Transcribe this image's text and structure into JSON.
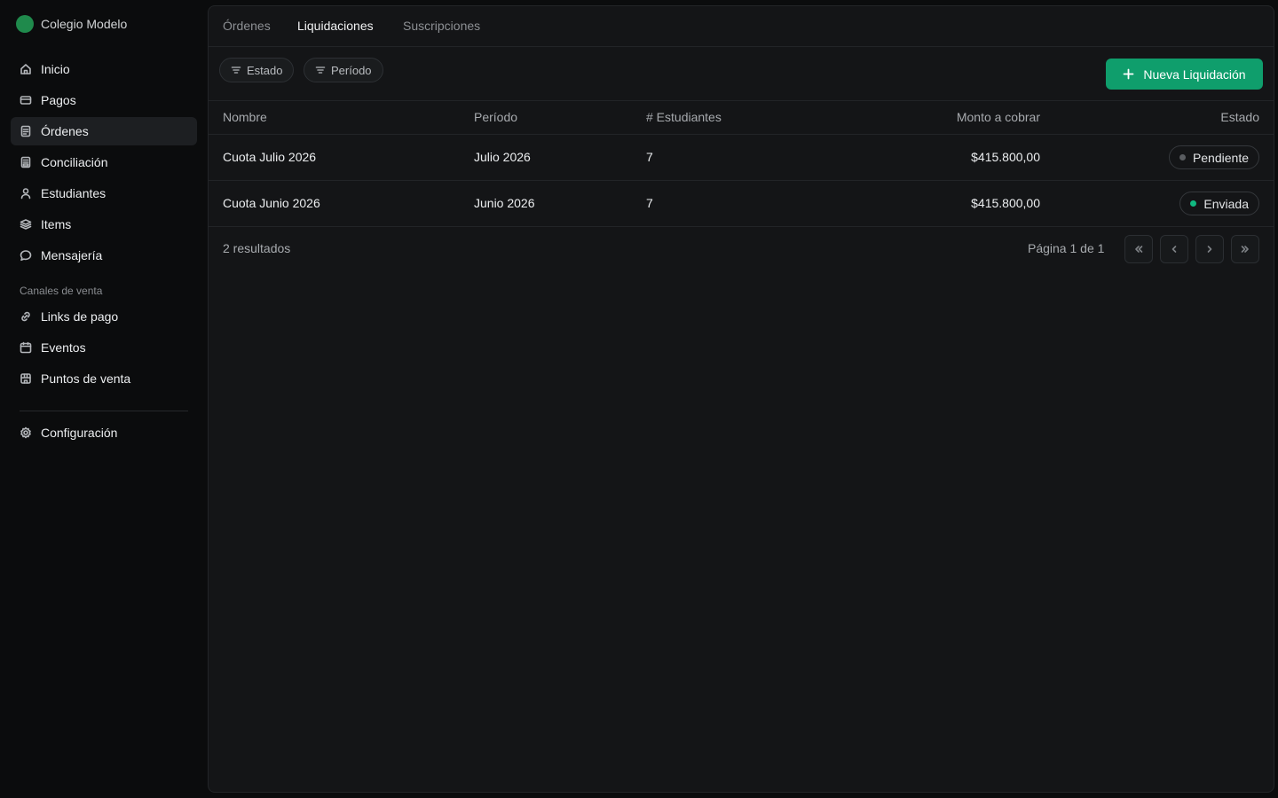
{
  "brand": {
    "name": "Colegio Modelo"
  },
  "sidebar": {
    "items": [
      {
        "label": "Inicio",
        "icon": "home-icon"
      },
      {
        "label": "Pagos",
        "icon": "credit-card-icon"
      },
      {
        "label": "Órdenes",
        "icon": "document-icon",
        "active": true
      },
      {
        "label": "Conciliación",
        "icon": "ledger-icon"
      },
      {
        "label": "Estudiantes",
        "icon": "user-icon"
      },
      {
        "label": "Items",
        "icon": "layers-icon"
      },
      {
        "label": "Mensajería",
        "icon": "message-icon"
      }
    ],
    "section_label": "Canales de venta",
    "channel_items": [
      {
        "label": "Links de pago",
        "icon": "link-icon"
      },
      {
        "label": "Eventos",
        "icon": "calendar-icon"
      },
      {
        "label": "Puntos de venta",
        "icon": "store-icon"
      }
    ],
    "settings": {
      "label": "Configuración",
      "icon": "gear-icon"
    }
  },
  "tabs": [
    {
      "label": "Órdenes"
    },
    {
      "label": "Liquidaciones",
      "active": true
    },
    {
      "label": "Suscripciones"
    }
  ],
  "filters": [
    {
      "label": "Estado"
    },
    {
      "label": "Período"
    }
  ],
  "actions": {
    "new_label": "Nueva Liquidación"
  },
  "table": {
    "columns": [
      "Nombre",
      "Período",
      "# Estudiantes",
      "Monto a cobrar",
      "Estado"
    ],
    "rows": [
      {
        "nombre": "Cuota Julio 2026",
        "periodo": "Julio 2026",
        "estudiantes": "7",
        "monto": "$415.800,00",
        "estado": "Pendiente",
        "estado_color": "#5a5d61"
      },
      {
        "nombre": "Cuota Junio 2026",
        "periodo": "Junio 2026",
        "estudiantes": "7",
        "monto": "$415.800,00",
        "estado": "Enviada",
        "estado_color": "#10b981"
      }
    ]
  },
  "footer": {
    "results": "2 resultados",
    "page_info": "Página 1 de 1"
  },
  "colors": {
    "accent": "#0f9e6c",
    "brand_logo": "#1f8a4c"
  }
}
